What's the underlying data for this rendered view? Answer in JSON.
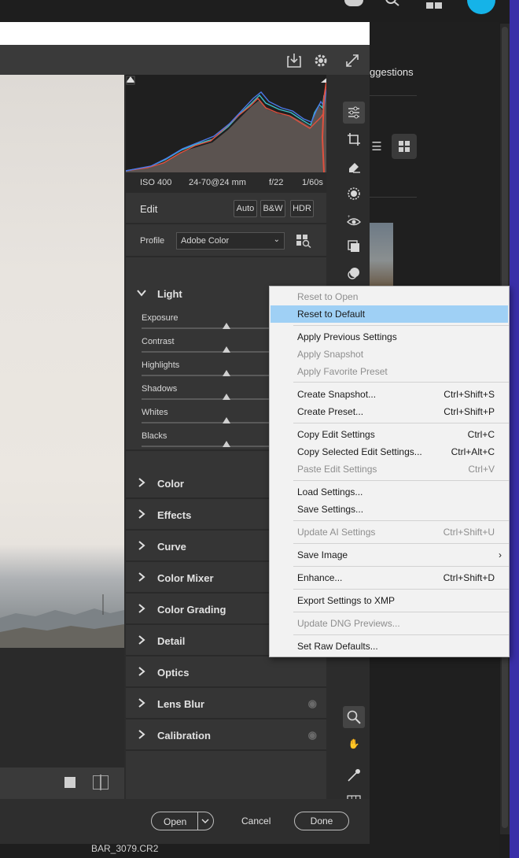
{
  "background": {
    "suggestions_label": "ggestions",
    "filename": "BAR_3079.CR2",
    "top_icons": [
      "cloud-icon",
      "search-icon",
      "grid-icon",
      "avatar"
    ]
  },
  "dialog": {
    "exif": {
      "iso": "ISO 400",
      "lens": "24-70@24 mm",
      "aperture": "f/22",
      "shutter": "1/60s"
    },
    "edit": {
      "title": "Edit",
      "auto": "Auto",
      "bw": "B&W",
      "hdr": "HDR"
    },
    "profile": {
      "label": "Profile",
      "value": "Adobe Color"
    },
    "light": {
      "title": "Light",
      "sliders": [
        {
          "label": "Exposure",
          "value": 0
        },
        {
          "label": "Contrast",
          "value": 0
        },
        {
          "label": "Highlights",
          "value": 0
        },
        {
          "label": "Shadows",
          "value": 0
        },
        {
          "label": "Whites",
          "value": 0
        },
        {
          "label": "Blacks",
          "value": 0
        }
      ]
    },
    "sections": [
      {
        "title": "Color",
        "eye": false
      },
      {
        "title": "Effects",
        "eye": false
      },
      {
        "title": "Curve",
        "eye": false
      },
      {
        "title": "Color Mixer",
        "eye": false
      },
      {
        "title": "Color Grading",
        "eye": false
      },
      {
        "title": "Detail",
        "eye": false
      },
      {
        "title": "Optics",
        "eye": false
      },
      {
        "title": "Lens Blur",
        "eye": true
      },
      {
        "title": "Calibration",
        "eye": true
      }
    ],
    "footer": {
      "open": "Open",
      "cancel": "Cancel",
      "done": "Done"
    }
  },
  "menu": {
    "items": [
      {
        "label": "Reset to Open",
        "shortcut": "",
        "disabled": true
      },
      {
        "label": "Reset to Default",
        "shortcut": "",
        "highlight": true
      },
      {
        "label": "Apply Previous Settings",
        "shortcut": ""
      },
      {
        "label": "Apply Snapshot",
        "shortcut": "",
        "disabled": true
      },
      {
        "label": "Apply Favorite Preset",
        "shortcut": "",
        "disabled": true
      },
      {
        "label": "Create Snapshot...",
        "shortcut": "Ctrl+Shift+S"
      },
      {
        "label": "Create Preset...",
        "shortcut": "Ctrl+Shift+P"
      },
      {
        "label": "Copy Edit Settings",
        "shortcut": "Ctrl+C"
      },
      {
        "label": "Copy Selected Edit Settings...",
        "shortcut": "Ctrl+Alt+C"
      },
      {
        "label": "Paste Edit Settings",
        "shortcut": "Ctrl+V",
        "disabled": true
      },
      {
        "label": "Load Settings...",
        "shortcut": ""
      },
      {
        "label": "Save Settings...",
        "shortcut": ""
      },
      {
        "label": "Update AI Settings",
        "shortcut": "Ctrl+Shift+U",
        "disabled": true
      },
      {
        "label": "Save Image",
        "shortcut": "›"
      },
      {
        "label": "Enhance...",
        "shortcut": "Ctrl+Shift+D"
      },
      {
        "label": "Export Settings to XMP",
        "shortcut": ""
      },
      {
        "label": "Update DNG Previews...",
        "shortcut": "",
        "disabled": true
      },
      {
        "label": "Set Raw Defaults...",
        "shortcut": ""
      }
    ]
  },
  "colors": {
    "accent_highlight": "#9fd0f5",
    "panel": "#353535",
    "menu_bg": "#f2f2f2"
  }
}
